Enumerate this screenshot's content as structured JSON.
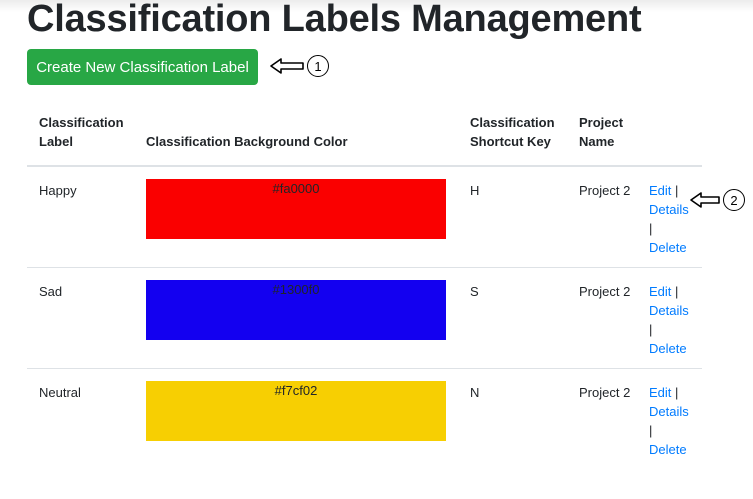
{
  "page": {
    "title": "Classification Labels Management"
  },
  "toolbar": {
    "create_label": "Create New Classification Label"
  },
  "callouts": {
    "one": "1",
    "two": "2"
  },
  "table": {
    "headers": {
      "label": "Classification Label",
      "color": "Classification Background Color",
      "shortcut": "Classification Shortcut Key",
      "project": "Project Name"
    },
    "rows": [
      {
        "label": "Happy",
        "color": "#fa0000",
        "shortcut": "H",
        "project": "Project 2"
      },
      {
        "label": "Sad",
        "color": "#1300f0",
        "shortcut": "S",
        "project": "Project 2"
      },
      {
        "label": "Neutral",
        "color": "#f7cf02",
        "shortcut": "N",
        "project": "Project 2"
      }
    ],
    "actions": {
      "edit": "Edit",
      "details": "Details",
      "delete": "Delete",
      "separator": "|"
    }
  }
}
